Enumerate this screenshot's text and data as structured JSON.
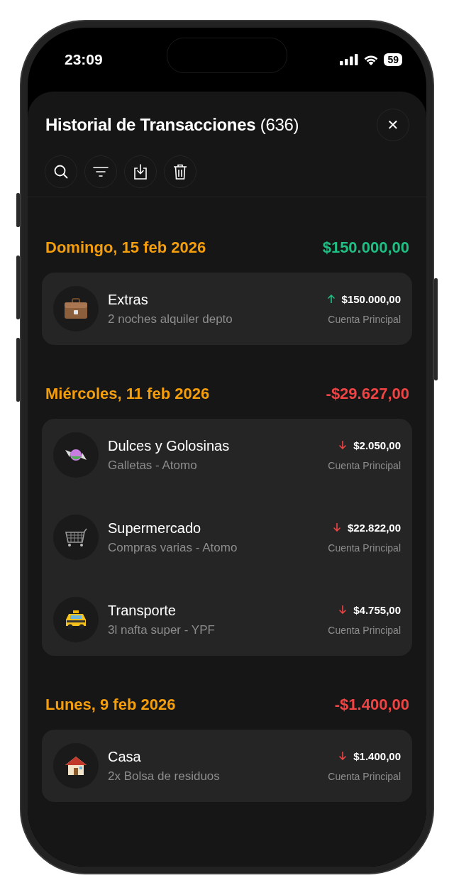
{
  "status_bar": {
    "time": "23:09",
    "battery": "59"
  },
  "header": {
    "title": "Historial de Transacciones",
    "count": "(636)",
    "close": "✕"
  },
  "days": [
    {
      "date": "Domingo, 15 feb 2026",
      "total": "$150.000,00",
      "kind": "income",
      "transactions": [
        {
          "category": "Extras",
          "note": "2 noches alquiler depto",
          "amount": "$150.000,00",
          "account": "Cuenta Principal",
          "kind": "income"
        }
      ]
    },
    {
      "date": "Miércoles, 11 feb 2026",
      "total": "-$29.627,00",
      "kind": "expense",
      "transactions": [
        {
          "category": "Dulces y Golosinas",
          "note": "Galletas - Atomo",
          "amount": "$2.050,00",
          "account": "Cuenta Principal",
          "kind": "expense"
        },
        {
          "category": "Supermercado",
          "note": "Compras varias - Atomo",
          "amount": "$22.822,00",
          "account": "Cuenta Principal",
          "kind": "expense"
        },
        {
          "category": "Transporte",
          "note": "3l nafta super - YPF",
          "amount": "$4.755,00",
          "account": "Cuenta Principal",
          "kind": "expense"
        }
      ]
    },
    {
      "date": "Lunes, 9 feb 2026",
      "total": "-$1.400,00",
      "kind": "expense",
      "transactions": [
        {
          "category": "Casa",
          "note": "2x Bolsa de residuos",
          "amount": "$1.400,00",
          "account": "Cuenta Principal",
          "kind": "expense"
        }
      ]
    }
  ]
}
